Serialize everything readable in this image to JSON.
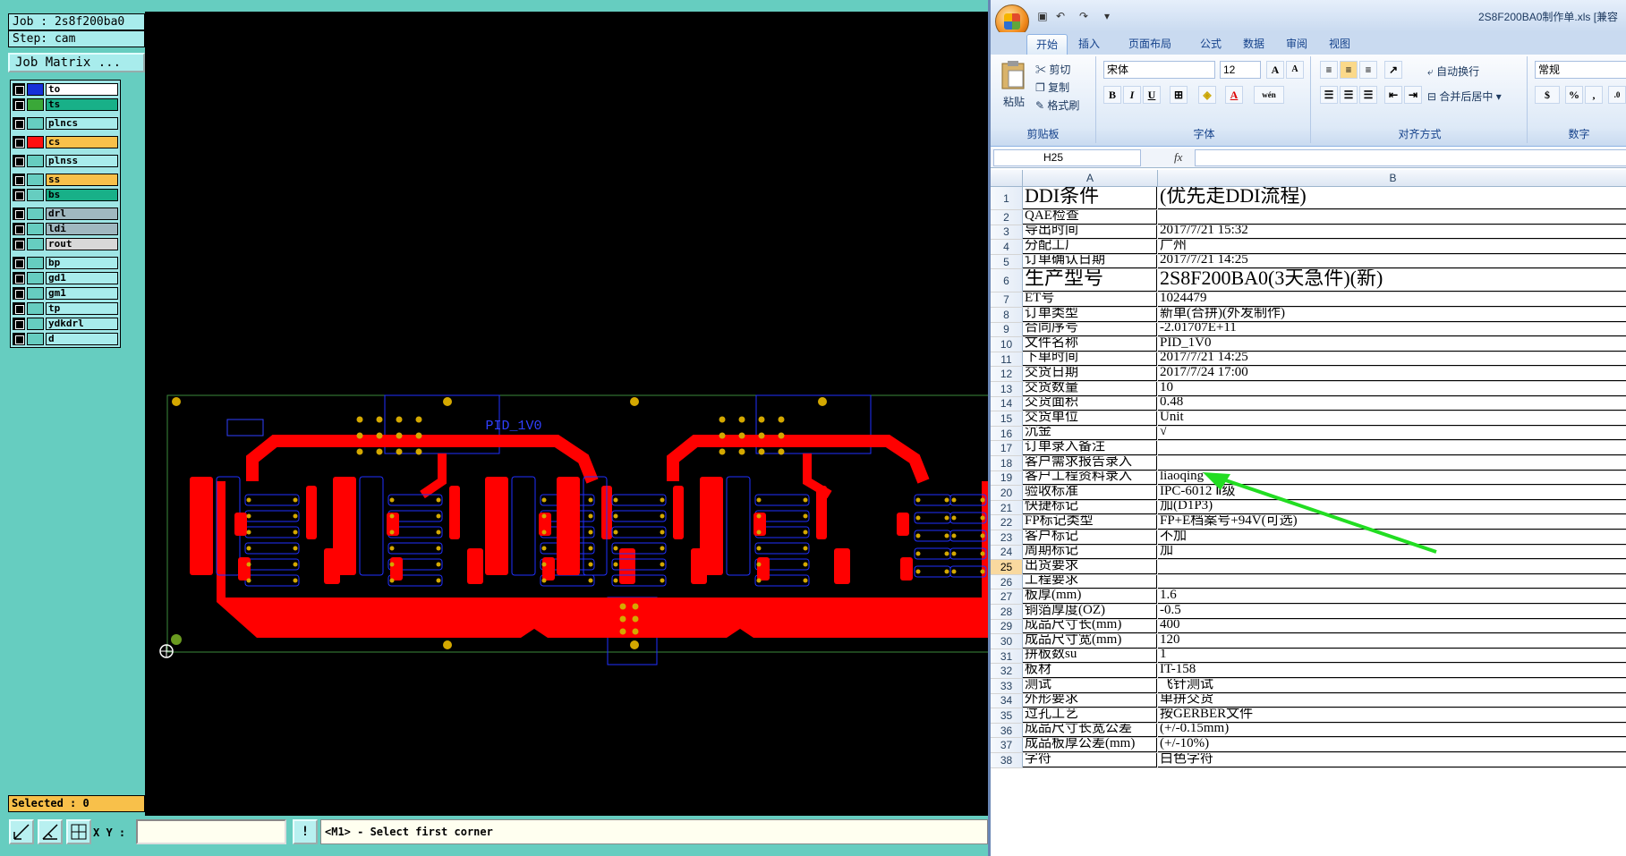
{
  "cam": {
    "job_line": "Job : 2s8f200ba0",
    "step_line": "Step: cam",
    "job_matrix_label": "Job Matrix ...",
    "layers": [
      {
        "name": "to",
        "color": "#1630d8",
        "bg": "#ffffff"
      },
      {
        "name": "ts",
        "color": "#3aa838",
        "bg": "#18b088"
      },
      {
        "name": "plncs",
        "color": "#66cdc0",
        "bg": "#a8ecec"
      },
      {
        "name": "cs",
        "color": "#ff1010",
        "bg": "#f8c04a"
      },
      {
        "name": "plnss",
        "color": "#66cdc0",
        "bg": "#a8ecec"
      },
      {
        "name": "ss",
        "color": "#66cdc0",
        "bg": "#f8c04a"
      },
      {
        "name": "bs",
        "color": "#66cdc0",
        "bg": "#18b088"
      },
      {
        "name": "drl",
        "color": "#66cdc0",
        "bg": "#a0b8c0"
      },
      {
        "name": "ldi",
        "color": "#66cdc0",
        "bg": "#a0b8c0"
      },
      {
        "name": "rout",
        "color": "#66cdc0",
        "bg": "#d8d8d8"
      },
      {
        "name": "bp",
        "color": "#66cdc0",
        "bg": "#a8ecec"
      },
      {
        "name": "gd1",
        "color": "#66cdc0",
        "bg": "#a8ecec"
      },
      {
        "name": "gm1",
        "color": "#66cdc0",
        "bg": "#a8ecec"
      },
      {
        "name": "tp",
        "color": "#66cdc0",
        "bg": "#a8ecec"
      },
      {
        "name": "ydkdrl",
        "color": "#66cdc0",
        "bg": "#a8ecec"
      },
      {
        "name": "d",
        "color": "#66cdc0",
        "bg": "#a8ecec"
      }
    ],
    "board_label": "PID_1V0",
    "selected_text": "Selected : 0",
    "xy_label": "X Y :",
    "xy_value": "",
    "xy_button": "!",
    "prompt": "<M1> - Select first corner"
  },
  "excel": {
    "window_title": "2S8F200BA0制作单.xls [兼容",
    "tabs": [
      "开始",
      "插入",
      "页面布局",
      "公式",
      "数据",
      "审阅",
      "视图"
    ],
    "active_tab": 0,
    "clipboard": {
      "paste": "粘贴",
      "cut": "剪切",
      "copy": "复制",
      "format_painter": "格式刷",
      "label": "剪贴板"
    },
    "font": {
      "name": "宋体",
      "size": "12",
      "label": "字体",
      "bold": "B",
      "italic": "I",
      "underline": "U",
      "grow": "A",
      "shrink": "A",
      "fill": "A",
      "wen": "wén"
    },
    "align": {
      "wrap": "自动换行",
      "merge": "合并后居中",
      "label": "对齐方式"
    },
    "number": {
      "format": "常规",
      "label": "数字",
      "percent": "%",
      "comma": ","
    },
    "name_box": "H25",
    "fx": "fx",
    "col_a": "A",
    "col_b": "B",
    "rows": [
      {
        "n": "1",
        "a": "DDI条件",
        "b": "(优先走DDI流程)",
        "big": true
      },
      {
        "n": "2",
        "a": "QAE检查",
        "b": ""
      },
      {
        "n": "3",
        "a": "导出时间",
        "b": "2017/7/21 15:32"
      },
      {
        "n": "4",
        "a": "分配工厂",
        "b": "广州"
      },
      {
        "n": "5",
        "a": "订单确认日期",
        "b": "2017/7/21 14:25"
      },
      {
        "n": "6",
        "a": "生产型号",
        "b": "2S8F200BA0(3天急件)(新)",
        "big": true
      },
      {
        "n": "7",
        "a": "ET号",
        "b": "1024479"
      },
      {
        "n": "8",
        "a": "订单类型",
        "b": "新单(合拼)(外发制作)"
      },
      {
        "n": "9",
        "a": "合同序号",
        "b": "-2.01707E+11"
      },
      {
        "n": "10",
        "a": "文件名称",
        "b": "PID_1V0"
      },
      {
        "n": "11",
        "a": "下单时间",
        "b": "2017/7/21 14:25"
      },
      {
        "n": "12",
        "a": "交货日期",
        "b": "2017/7/24 17:00"
      },
      {
        "n": "13",
        "a": "交货数量",
        "b": "10"
      },
      {
        "n": "14",
        "a": "交货面积",
        "b": "0.48"
      },
      {
        "n": "15",
        "a": "交货单位",
        "b": "Unit"
      },
      {
        "n": "16",
        "a": "沉金",
        "b": "√"
      },
      {
        "n": "17",
        "a": "订单录入备注",
        "b": ""
      },
      {
        "n": "18",
        "a": "客户需求报告录入",
        "b": ""
      },
      {
        "n": "19",
        "a": "客户工程资料录入",
        "b": "liaoqing"
      },
      {
        "n": "20",
        "a": "验收标准",
        "b": "IPC-6012 Ⅱ级"
      },
      {
        "n": "21",
        "a": "快捷标记",
        "b": "加(D1P3)"
      },
      {
        "n": "22",
        "a": "FP标记类型",
        "b": "FP+E档案号+94V(可选)"
      },
      {
        "n": "23",
        "a": "客户标记",
        "b": "不加"
      },
      {
        "n": "24",
        "a": "周期标记",
        "b": "加"
      },
      {
        "n": "25",
        "a": "出货要求",
        "b": "",
        "selected": true
      },
      {
        "n": "26",
        "a": "工程要求",
        "b": ""
      },
      {
        "n": "27",
        "a": "板厚(mm)",
        "b": "1.6"
      },
      {
        "n": "28",
        "a": "铜箔厚度(OZ)",
        "b": "-0.5"
      },
      {
        "n": "29",
        "a": "成品尺寸长(mm)",
        "b": "400"
      },
      {
        "n": "30",
        "a": "成品尺寸宽(mm)",
        "b": "120"
      },
      {
        "n": "31",
        "a": "拼板数su",
        "b": "1"
      },
      {
        "n": "32",
        "a": "板材",
        "b": "IT-158"
      },
      {
        "n": "33",
        "a": "测试",
        "b": "飞针测试"
      },
      {
        "n": "34",
        "a": "外形要求",
        "b": "单拼交货"
      },
      {
        "n": "35",
        "a": "过孔工艺",
        "b": "按GERBER文件"
      },
      {
        "n": "36",
        "a": "成品尺寸长宽公差",
        "b": "(+/-0.15mm)"
      },
      {
        "n": "37",
        "a": "成品板厚公差(mm)",
        "b": "(+/-10%)"
      },
      {
        "n": "38",
        "a": "字符",
        "b": "白色字符"
      }
    ]
  },
  "colors": {
    "annotation_arrow": "#22dd22",
    "copper": "#ff0000",
    "pad": "#d4a800",
    "outline": "#2030ff"
  }
}
